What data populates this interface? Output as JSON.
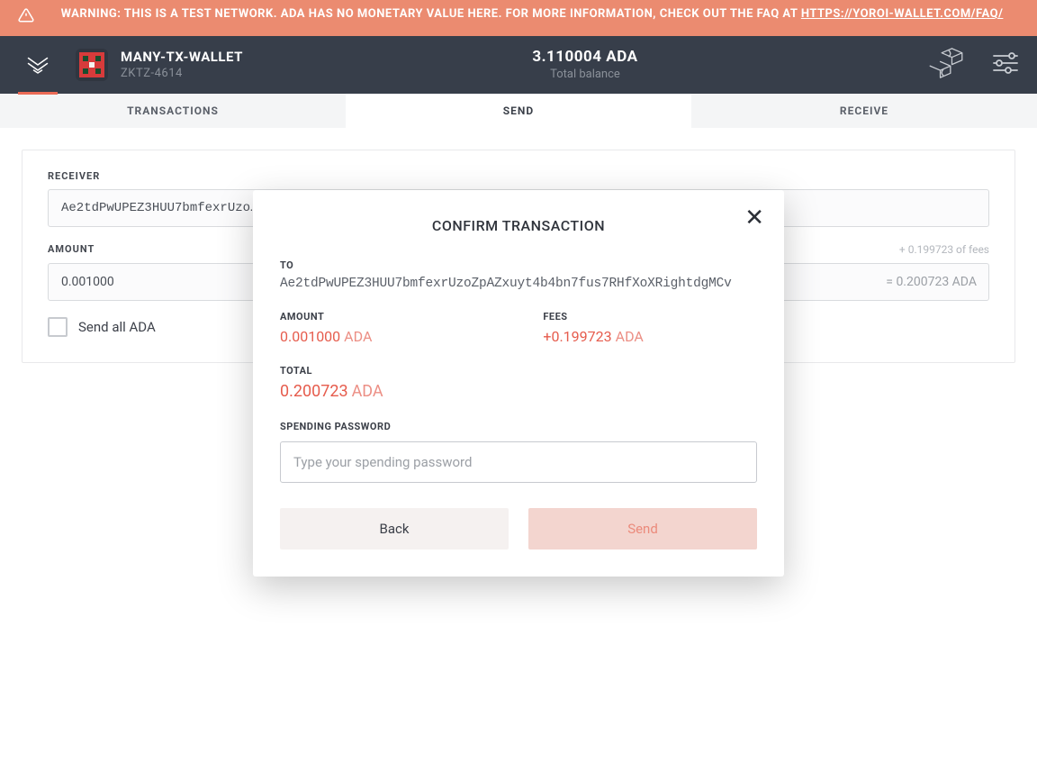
{
  "warning": {
    "text_prefix": "WARNING: THIS IS A TEST NETWORK. ADA HAS NO MONETARY VALUE HERE. FOR MORE INFORMATION, CHECK OUT THE FAQ AT ",
    "link_text": "HTTPS://YOROI-WALLET.COM/FAQ/"
  },
  "header": {
    "wallet_name": "MANY-TX-WALLET",
    "wallet_code": "ZKTZ-4614",
    "balance_amount": "3.110004 ADA",
    "balance_label": "Total balance"
  },
  "tabs": {
    "transactions": "TRANSACTIONS",
    "send": "SEND",
    "receive": "RECEIVE"
  },
  "send_form": {
    "receiver_label": "RECEIVER",
    "receiver_value": "Ae2tdPwUPEZ3HUU7bmfexrUzo…",
    "amount_label": "AMOUNT",
    "amount_value": "0.001000",
    "fees_hint": "+ 0.199723 of fees",
    "amount_suffix": "= 0.200723 ADA",
    "send_all_label": "Send all ADA"
  },
  "modal": {
    "title": "CONFIRM TRANSACTION",
    "to_label": "TO",
    "to_address": "Ae2tdPwUPEZ3HUU7bmfexrUzoZpAZxuyt4b4bn7fus7RHfXoXRightdgMCv",
    "amount_label": "AMOUNT",
    "amount_num": "0.001000",
    "amount_unit": "ADA",
    "fees_label": "FEES",
    "fees_num": "+0.199723",
    "fees_unit": "ADA",
    "total_label": "TOTAL",
    "total_num": "0.200723",
    "total_unit": "ADA",
    "password_label": "SPENDING PASSWORD",
    "password_placeholder": "Type your spending password",
    "back_label": "Back",
    "send_label": "Send"
  }
}
